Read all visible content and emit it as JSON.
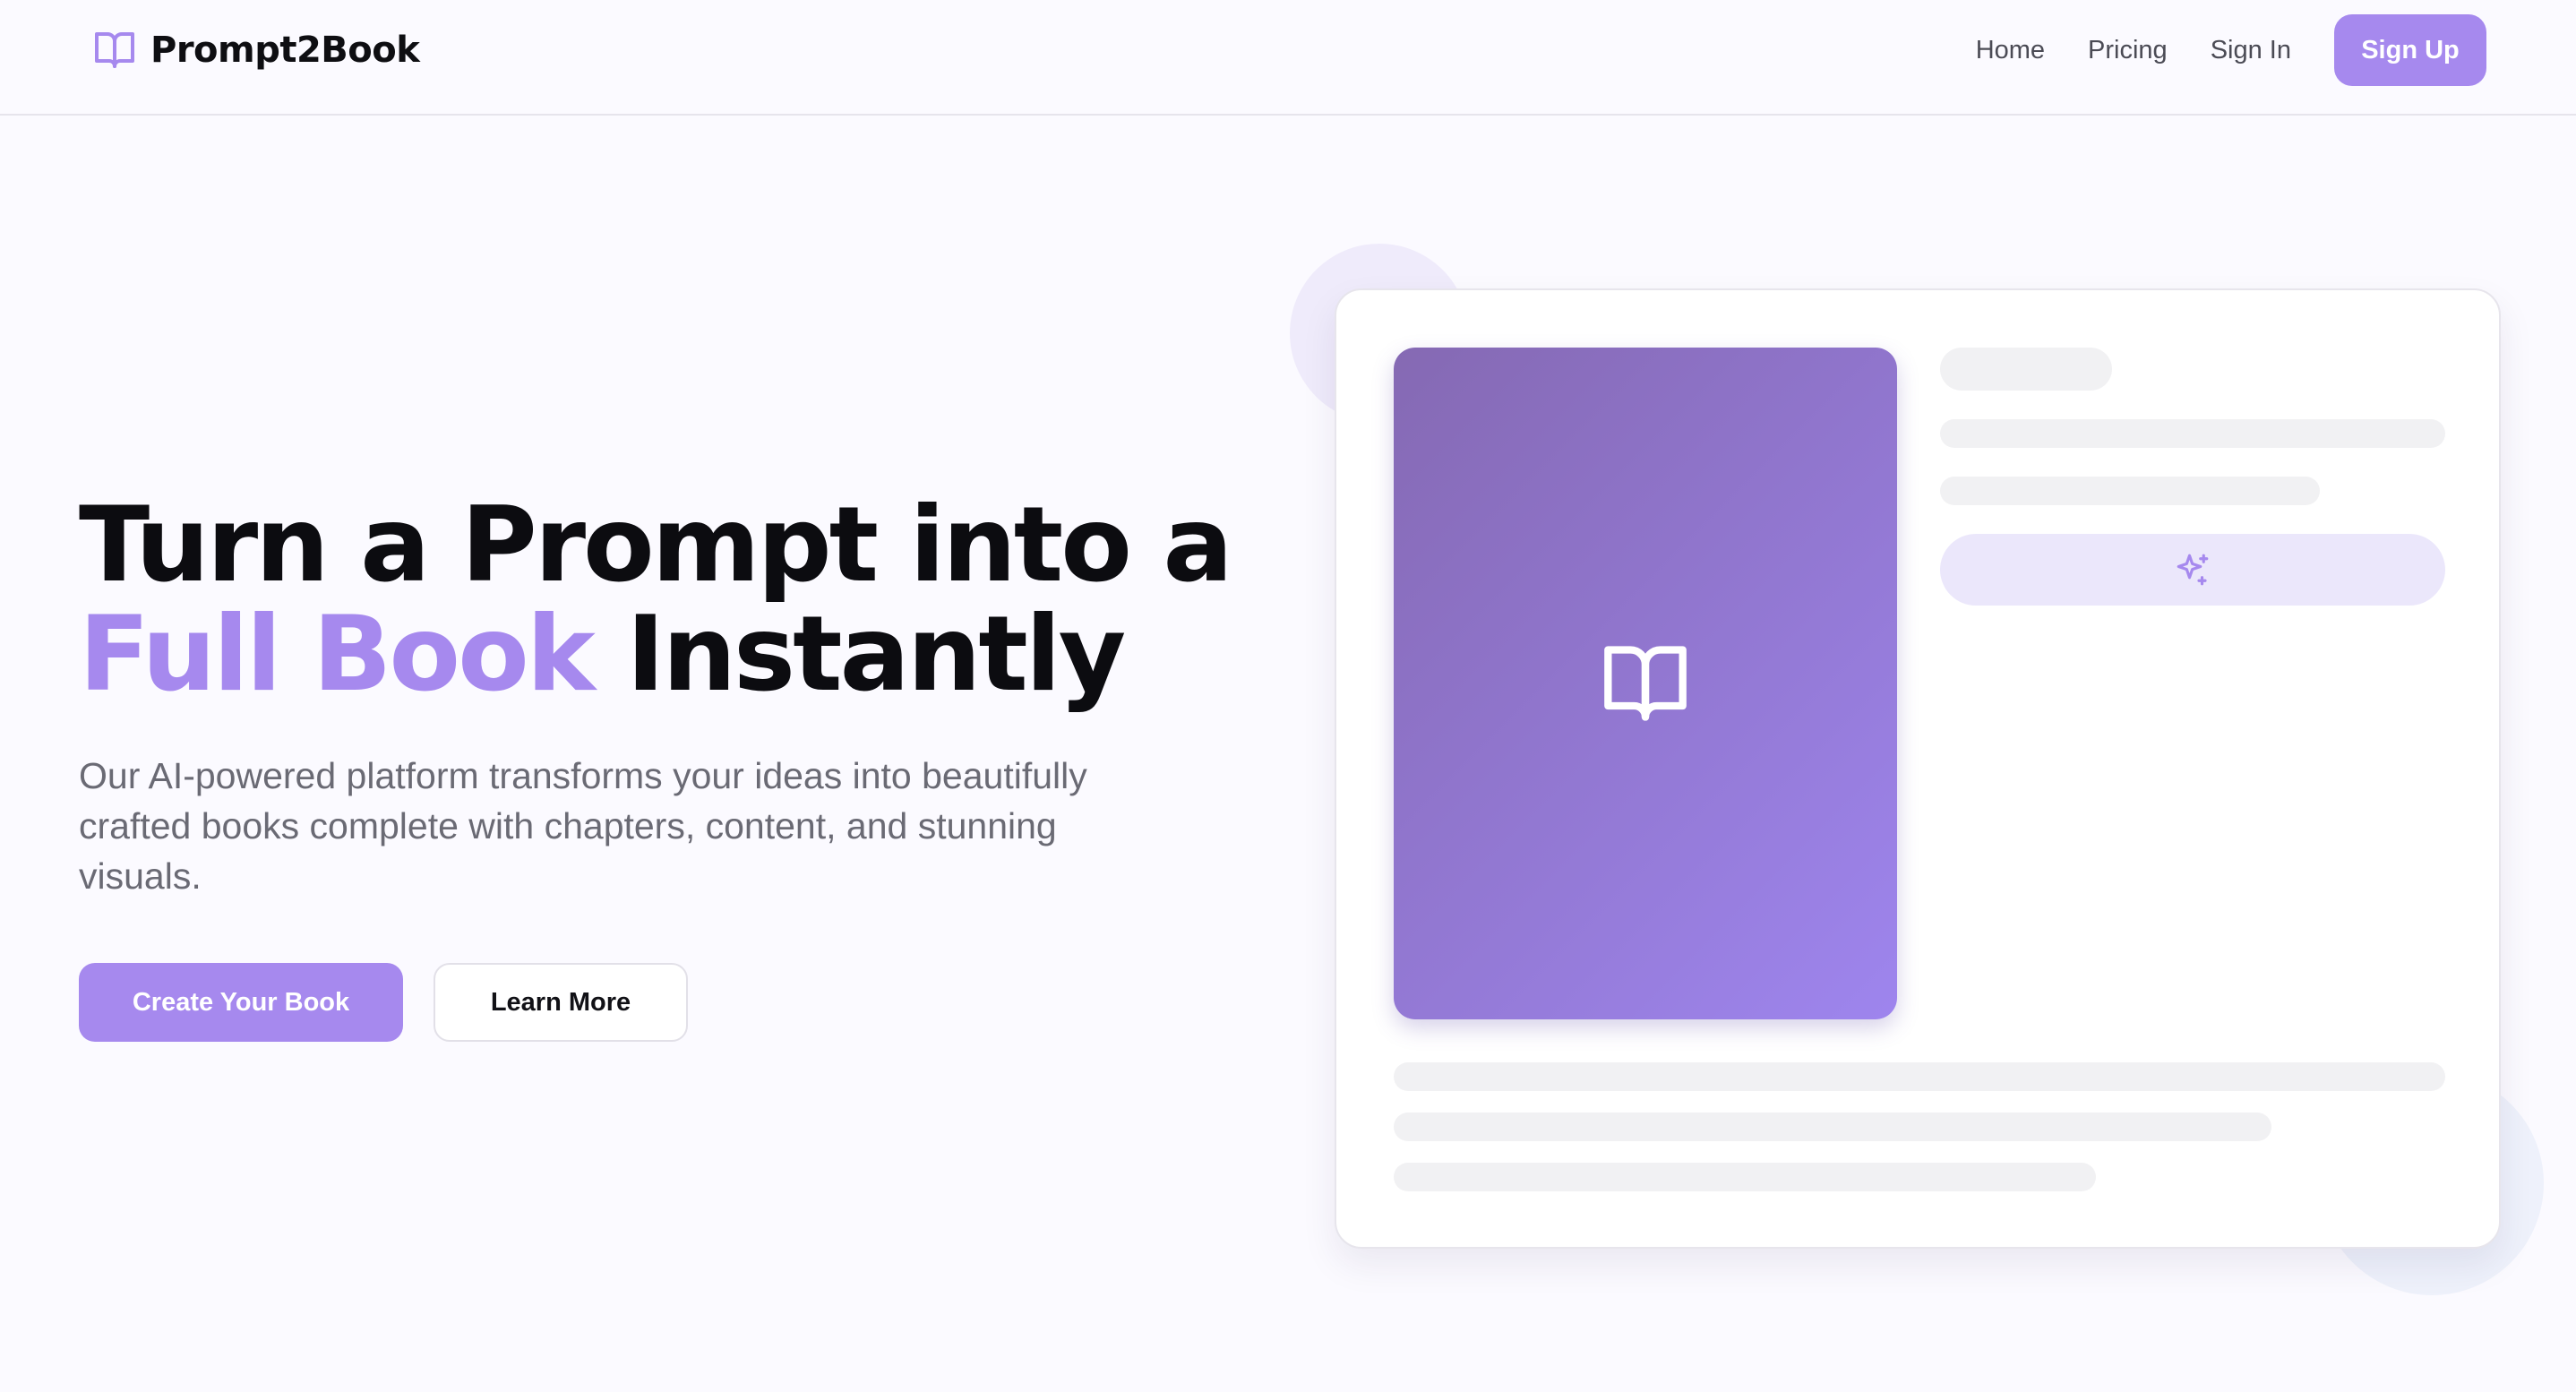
{
  "colors": {
    "accent": "#a689ee",
    "text": "#0c0c10",
    "muted": "#6a6a74",
    "background": "#fbfaff",
    "cover_gradient_start": "#8569b3",
    "cover_gradient_end": "#9e85ee"
  },
  "header": {
    "logo_icon": "open-book-icon",
    "brand_name": "Prompt2Book",
    "nav": {
      "home": "Home",
      "pricing": "Pricing",
      "sign_in": "Sign In",
      "sign_up": "Sign Up"
    }
  },
  "hero": {
    "title_line1": "Turn a Prompt into a",
    "title_accent": "Full Book",
    "title_rest": "Instantly",
    "subtitle": "Our AI-powered platform transforms your ideas into beautifully crafted books complete with chapters, content, and stunning visuals.",
    "primary_cta": "Create Your Book",
    "secondary_cta": "Learn More"
  },
  "preview": {
    "cover_icon": "open-book-icon",
    "generate_icon": "sparkles-icon"
  }
}
